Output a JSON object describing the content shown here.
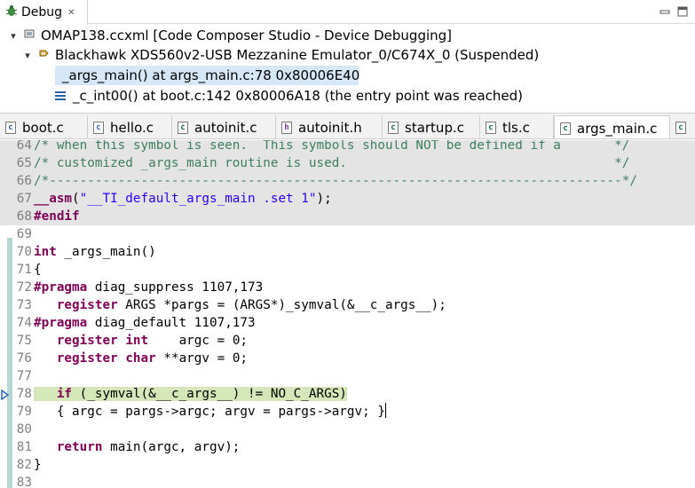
{
  "debug_view": {
    "tab_title": "Debug",
    "tab_close": "✕",
    "tree": [
      {
        "label": "OMAP138.ccxml [Code Composer Studio - Device Debugging]"
      },
      {
        "label": "Blackhawk XDS560v2-USB Mezzanine Emulator_0/C674X_0 (Suspended)"
      },
      {
        "label": "_args_main() at args_main.c:78 0x80006E40"
      },
      {
        "label": "_c_int00() at boot.c:142 0x80006A18  (the entry point was reached)"
      }
    ]
  },
  "editor_tabs": [
    {
      "label": "boot.c",
      "icon": "c-file-icon"
    },
    {
      "label": "hello.c",
      "icon": "c-file-icon"
    },
    {
      "label": "autoinit.c",
      "icon": "c-file-icon"
    },
    {
      "label": "autoinit.h",
      "icon": "h-file-icon"
    },
    {
      "label": "startup.c",
      "icon": "c-file-icon"
    },
    {
      "label": "tls.c",
      "icon": "c-file-icon"
    },
    {
      "label": "args_main.c",
      "icon": "c-file-icon",
      "active": true
    }
  ],
  "code": [
    {
      "n": "64",
      "parts": [
        [
          "com",
          "/* when this symbol is seen.  This symbols should NOT be defined if a       */"
        ]
      ],
      "inactive": true
    },
    {
      "n": "65",
      "parts": [
        [
          "com",
          "/* customized _args_main routine is used.                                   */"
        ]
      ],
      "inactive": true
    },
    {
      "n": "66",
      "parts": [
        [
          "com",
          "/*---------------------------------------------------------------------------*/"
        ]
      ],
      "inactive": true
    },
    {
      "n": "67",
      "parts": [
        [
          "asm",
          "__asm"
        ],
        [
          "",
          "("
        ],
        [
          "str",
          "\"__TI_default_args_main .set 1\""
        ],
        [
          "",
          ");"
        ]
      ],
      "inactive": true
    },
    {
      "n": "68",
      "parts": [
        [
          "mac",
          "#endif"
        ]
      ],
      "inactive": true
    },
    {
      "n": "69",
      "parts": [
        [
          "",
          ""
        ]
      ]
    },
    {
      "n": "70",
      "parts": [
        [
          "kw",
          "int"
        ],
        [
          "",
          " _args_main()"
        ]
      ]
    },
    {
      "n": "71",
      "parts": [
        [
          "",
          "{"
        ]
      ]
    },
    {
      "n": "72",
      "parts": [
        [
          "mac",
          "#pragma"
        ],
        [
          "",
          " diag_suppress 1107,173"
        ]
      ]
    },
    {
      "n": "73",
      "parts": [
        [
          "",
          "   "
        ],
        [
          "kw",
          "register"
        ],
        [
          "",
          " ARGS *pargs = (ARGS*)_symval(&__c_args__);"
        ]
      ]
    },
    {
      "n": "74",
      "parts": [
        [
          "mac",
          "#pragma"
        ],
        [
          "",
          " diag_default 1107,173"
        ]
      ]
    },
    {
      "n": "75",
      "parts": [
        [
          "",
          "   "
        ],
        [
          "kw",
          "register"
        ],
        [
          "",
          " "
        ],
        [
          "kw",
          "int"
        ],
        [
          "",
          "    argc = 0;"
        ]
      ]
    },
    {
      "n": "76",
      "parts": [
        [
          "",
          "   "
        ],
        [
          "kw",
          "register"
        ],
        [
          "",
          " "
        ],
        [
          "kw",
          "char"
        ],
        [
          "",
          " **argv = 0;"
        ]
      ]
    },
    {
      "n": "77",
      "parts": [
        [
          "",
          ""
        ]
      ]
    },
    {
      "n": "78",
      "parts": [
        [
          "",
          "   "
        ],
        [
          "kw",
          "if"
        ],
        [
          "",
          " (_symval(&__c_args__) != NO_C_ARGS)"
        ]
      ],
      "current": true
    },
    {
      "n": "79",
      "parts": [
        [
          "",
          "   { argc = pargs->argc; argv = pargs->argv; }"
        ]
      ],
      "cursor": true
    },
    {
      "n": "80",
      "parts": [
        [
          "",
          ""
        ]
      ]
    },
    {
      "n": "81",
      "parts": [
        [
          "",
          "   "
        ],
        [
          "kw",
          "return"
        ],
        [
          "",
          " main(argc, argv);"
        ]
      ]
    },
    {
      "n": "82",
      "parts": [
        [
          "",
          "}"
        ]
      ]
    },
    {
      "n": "83",
      "parts": [
        [
          "",
          ""
        ]
      ]
    }
  ]
}
